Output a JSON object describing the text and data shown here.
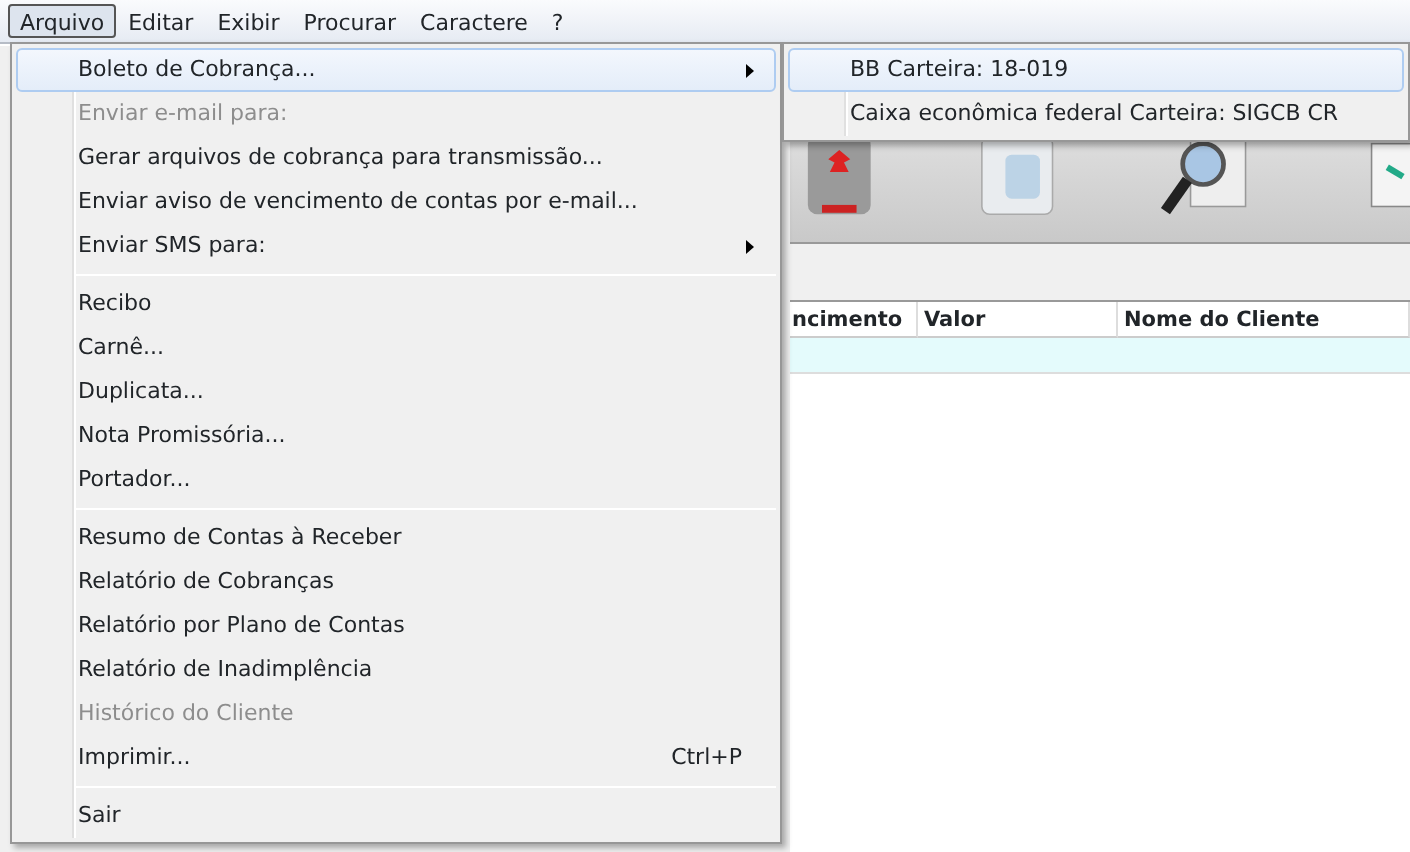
{
  "menubar": [
    {
      "label": "Arquivo",
      "selected": true
    },
    {
      "label": "Editar",
      "selected": false
    },
    {
      "label": "Exibir",
      "selected": false
    },
    {
      "label": "Procurar",
      "selected": false
    },
    {
      "label": "Caractere",
      "selected": false
    },
    {
      "label": "?",
      "selected": false
    }
  ],
  "menu": [
    {
      "kind": "item",
      "label": "Boleto de Cobrança...",
      "selected": true,
      "disabled": false,
      "submenu": true
    },
    {
      "kind": "item",
      "label": "Enviar e-mail para:",
      "selected": false,
      "disabled": true,
      "submenu": false
    },
    {
      "kind": "item",
      "label": "Gerar arquivos de cobrança para transmissão...",
      "selected": false,
      "disabled": false,
      "submenu": false
    },
    {
      "kind": "item",
      "label": "Enviar aviso de vencimento de contas por e-mail...",
      "selected": false,
      "disabled": false,
      "submenu": false
    },
    {
      "kind": "item",
      "label": "Enviar SMS para:",
      "selected": false,
      "disabled": false,
      "submenu": true
    },
    {
      "kind": "separator"
    },
    {
      "kind": "item",
      "label": "Recibo",
      "selected": false,
      "disabled": false,
      "submenu": false
    },
    {
      "kind": "item",
      "label": "Carnê...",
      "selected": false,
      "disabled": false,
      "submenu": false
    },
    {
      "kind": "item",
      "label": "Duplicata...",
      "selected": false,
      "disabled": false,
      "submenu": false
    },
    {
      "kind": "item",
      "label": "Nota Promissória...",
      "selected": false,
      "disabled": false,
      "submenu": false
    },
    {
      "kind": "item",
      "label": "Portador...",
      "selected": false,
      "disabled": false,
      "submenu": false
    },
    {
      "kind": "separator"
    },
    {
      "kind": "item",
      "label": "Resumo de Contas à Receber",
      "selected": false,
      "disabled": false,
      "submenu": false
    },
    {
      "kind": "item",
      "label": "Relatório de Cobranças",
      "selected": false,
      "disabled": false,
      "submenu": false
    },
    {
      "kind": "item",
      "label": "Relatório por Plano de Contas",
      "selected": false,
      "disabled": false,
      "submenu": false
    },
    {
      "kind": "item",
      "label": "Relatório de Inadimplência",
      "selected": false,
      "disabled": false,
      "submenu": false
    },
    {
      "kind": "item",
      "label": "Histórico do Cliente",
      "selected": false,
      "disabled": true,
      "submenu": false
    },
    {
      "kind": "item",
      "label": "Imprimir...",
      "shortcut": "Ctrl+P",
      "selected": false,
      "disabled": false,
      "submenu": false
    },
    {
      "kind": "separator"
    },
    {
      "kind": "item",
      "label": "Sair",
      "selected": false,
      "disabled": false,
      "submenu": false
    }
  ],
  "submenu": [
    {
      "label": "BB Carteira: 18-019",
      "selected": true
    },
    {
      "label": "Caixa econômica federal Carteira: SIGCB CR",
      "selected": false
    }
  ],
  "table": {
    "columns": [
      "ncimento",
      "Valor",
      "Nome do Cliente"
    ]
  }
}
